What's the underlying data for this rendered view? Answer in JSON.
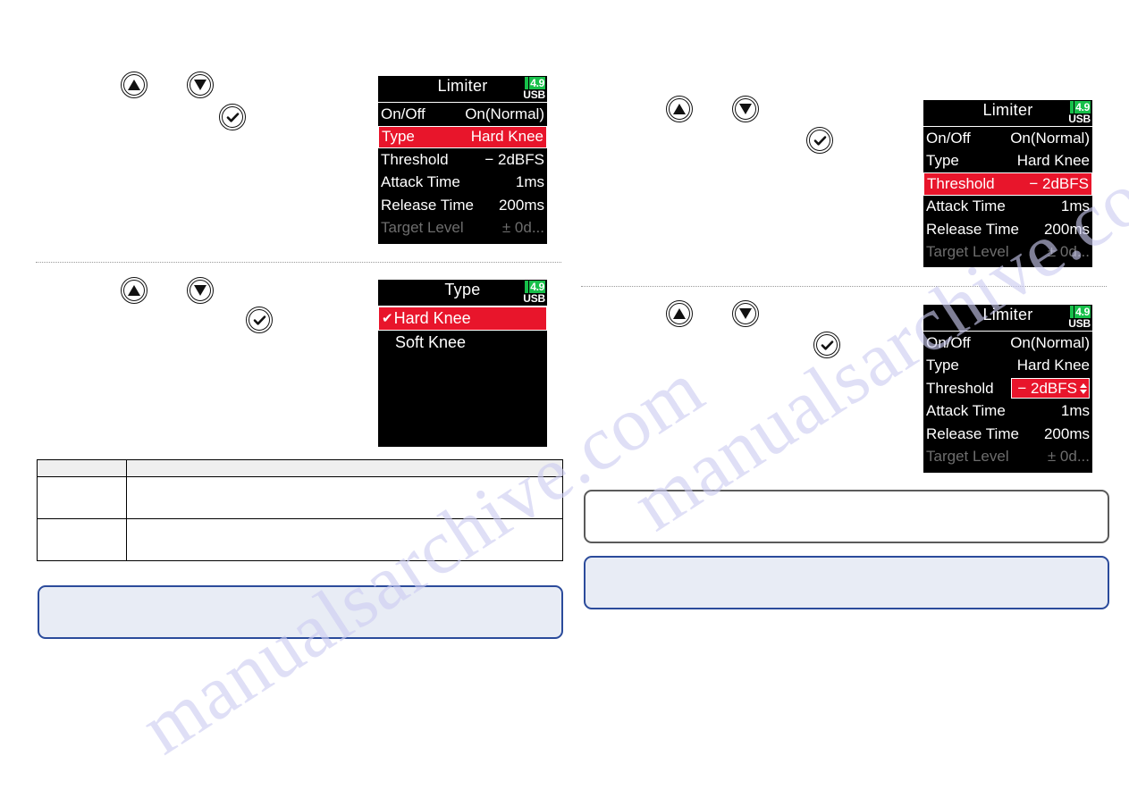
{
  "page": {
    "watermark_text": "manualsarchive.com"
  },
  "colors": {
    "lcd_background": "#000000",
    "lcd_text": "#ffffff",
    "lcd_dim_text": "#6d6d6d",
    "selection_red": "#e8152b",
    "battery_green": "#17c04a",
    "note_border_blue": "#2b4b9b",
    "note_fill_blue": "#e8ecf5",
    "plain_border_gray": "#5a5a5a",
    "table_header_fill": "#efefef"
  },
  "icons": {
    "up_button": "triangle-up",
    "down_button": "triangle-down",
    "enter_button": "checkmark"
  },
  "left_column": {
    "step1": {
      "buttons": [
        {
          "name": "up-button",
          "glyph": "triangle-up"
        },
        {
          "name": "down-button",
          "glyph": "triangle-down"
        },
        {
          "name": "enter-button",
          "glyph": "checkmark"
        }
      ],
      "screen": {
        "title": "Limiter",
        "status": {
          "battery_value": "4.9",
          "usb_label": "USB"
        },
        "rows": [
          {
            "label": "On/Off",
            "value": "On(Normal)",
            "state": "normal"
          },
          {
            "label": "Type",
            "value": "Hard Knee",
            "state": "selected"
          },
          {
            "label": "Threshold",
            "value": "− 2dBFS",
            "state": "normal"
          },
          {
            "label": "Attack Time",
            "value": "1ms",
            "state": "normal"
          },
          {
            "label": "Release Time",
            "value": "200ms",
            "state": "normal"
          },
          {
            "label": "Target Level",
            "value": "± 0d...",
            "state": "dim"
          }
        ]
      }
    },
    "step2": {
      "buttons": [
        {
          "name": "up-button",
          "glyph": "triangle-up"
        },
        {
          "name": "down-button",
          "glyph": "triangle-down"
        },
        {
          "name": "enter-button",
          "glyph": "checkmark"
        }
      ],
      "screen": {
        "title": "Type",
        "status": {
          "battery_value": "4.9",
          "usb_label": "USB"
        },
        "options": [
          {
            "label": "Hard Knee",
            "checked": true,
            "state": "selected"
          },
          {
            "label": "Soft Knee",
            "checked": false,
            "state": "normal"
          }
        ]
      }
    },
    "table": {
      "header": [
        "",
        ""
      ],
      "rows": [
        [
          "",
          ""
        ],
        [
          "",
          ""
        ]
      ]
    },
    "note_box": {
      "text": ""
    }
  },
  "right_column": {
    "step1": {
      "buttons": [
        {
          "name": "up-button",
          "glyph": "triangle-up"
        },
        {
          "name": "down-button",
          "glyph": "triangle-down"
        },
        {
          "name": "enter-button",
          "glyph": "checkmark"
        }
      ],
      "screen": {
        "title": "Limiter",
        "status": {
          "battery_value": "4.9",
          "usb_label": "USB"
        },
        "rows": [
          {
            "label": "On/Off",
            "value": "On(Normal)",
            "state": "normal"
          },
          {
            "label": "Type",
            "value": "Hard Knee",
            "state": "normal"
          },
          {
            "label": "Threshold",
            "value": "− 2dBFS",
            "state": "selected"
          },
          {
            "label": "Attack Time",
            "value": "1ms",
            "state": "normal"
          },
          {
            "label": "Release Time",
            "value": "200ms",
            "state": "normal"
          },
          {
            "label": "Target Level",
            "value": "± 0d...",
            "state": "dim"
          }
        ]
      }
    },
    "step2": {
      "buttons": [
        {
          "name": "up-button",
          "glyph": "triangle-up"
        },
        {
          "name": "down-button",
          "glyph": "triangle-down"
        },
        {
          "name": "enter-button",
          "glyph": "checkmark"
        }
      ],
      "screen": {
        "title": "Limiter",
        "status": {
          "battery_value": "4.9",
          "usb_label": "USB"
        },
        "rows": [
          {
            "label": "On/Off",
            "value": "On(Normal)",
            "state": "normal"
          },
          {
            "label": "Type",
            "value": "Hard Knee",
            "state": "normal"
          },
          {
            "label": "Threshold",
            "value": "− 2dBFS",
            "state": "value-edit"
          },
          {
            "label": "Attack Time",
            "value": "1ms",
            "state": "normal"
          },
          {
            "label": "Release Time",
            "value": "200ms",
            "state": "normal"
          },
          {
            "label": "Target Level",
            "value": "± 0d...",
            "state": "dim"
          }
        ]
      }
    },
    "plain_box": {
      "text": ""
    },
    "note_box": {
      "text": ""
    }
  }
}
